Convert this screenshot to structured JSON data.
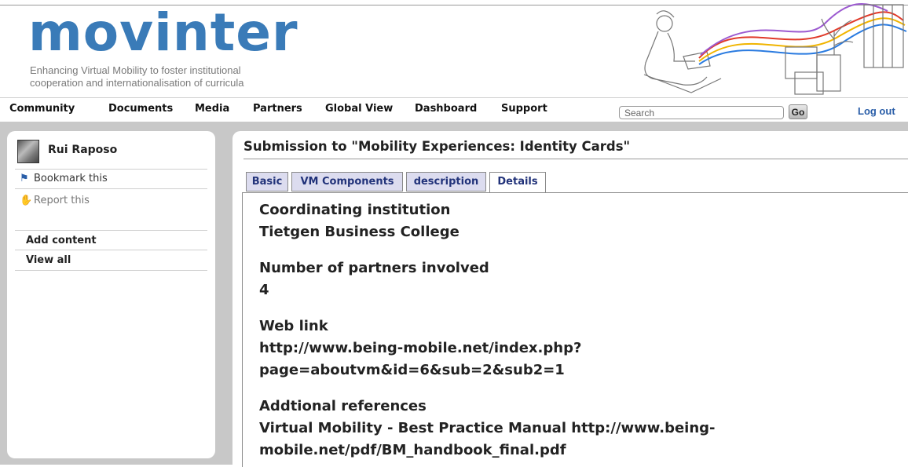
{
  "brand": {
    "logo": "movinter",
    "tagline_line1": "Enhancing Virtual Mobility to foster institutional",
    "tagline_line2": "cooperation and internationalisation of curricula"
  },
  "nav": {
    "items": [
      "Community",
      "Documents",
      "Media",
      "Partners",
      "Global View",
      "Dashboard",
      "Support"
    ],
    "search_placeholder": "Search",
    "go_label": "Go",
    "logout_label": "Log out"
  },
  "sidebar": {
    "user_name": "Rui Raposo",
    "bookmark_label": "Bookmark this",
    "report_label": "Report this",
    "add_content_label": "Add content",
    "view_all_label": "View all"
  },
  "main": {
    "title": "Submission to \"Mobility Experiences: Identity Cards\"",
    "tabs": [
      "Basic",
      "VM Components",
      "description",
      "Details"
    ],
    "active_tab": "Details",
    "fields": {
      "coordinating_label": "Coordinating institution",
      "coordinating_value": "Tietgen Business College",
      "partners_label": "Number of partners involved",
      "partners_value": "4",
      "weblink_label": "Web link",
      "weblink_line1": "http://www.being-mobile.net/index.php?",
      "weblink_line2": "page=aboutvm&id=6&sub=2&sub2=1",
      "refs_label": "Addtional references",
      "refs_line1": "Virtual Mobility - Best Practice Manual http://www.being-",
      "refs_line2": "mobile.net/pdf/BM_handbook_final.pdf"
    }
  },
  "colors": {
    "brand_blue": "#3a7bb8",
    "link_blue": "#2a5ea8",
    "tab_bg": "#dcdcef",
    "body_grey": "#c8c8c8"
  }
}
